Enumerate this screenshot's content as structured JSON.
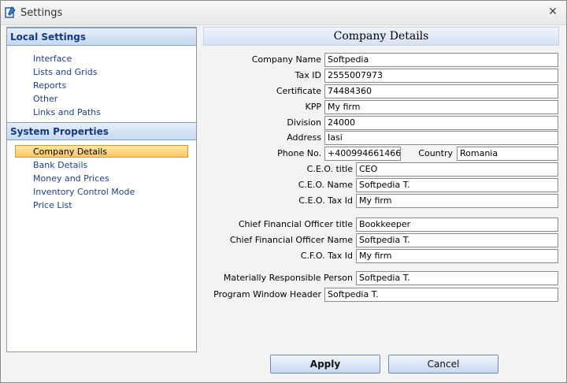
{
  "window": {
    "title": "Settings",
    "close_glyph": "✕"
  },
  "sidebar": {
    "local_settings": {
      "header": "Local Settings",
      "items": [
        "Interface",
        "Lists and Grids",
        "Reports",
        "Other",
        "Links and Paths"
      ]
    },
    "system_properties": {
      "header": "System Properties",
      "items": [
        "Company Details",
        "Bank Details",
        "Money and Prices",
        "Inventory Control Mode",
        "Price List"
      ],
      "selected": "Company Details"
    }
  },
  "main": {
    "heading": "Company Details",
    "fields": {
      "company_name": {
        "label": "Company Name",
        "value": "Softpedia"
      },
      "tax_id": {
        "label": "Tax ID",
        "value": "2555007973"
      },
      "certificate": {
        "label": "Certificate",
        "value": "74484360"
      },
      "kpp": {
        "label": "KPP",
        "value": "My firm"
      },
      "division": {
        "label": "Division",
        "value": "24000"
      },
      "address": {
        "label": "Address",
        "value": "Iasi"
      },
      "phone": {
        "label": "Phone No.",
        "value": "+400994661466"
      },
      "country": {
        "label": "Country",
        "value": "Romania"
      },
      "ceo_title": {
        "label": "C.E.O. title",
        "value": "CEO"
      },
      "ceo_name": {
        "label": "C.E.O. Name",
        "value": "Softpedia T."
      },
      "ceo_tax_id": {
        "label": "C.E.O. Tax Id",
        "value": "My firm"
      },
      "cfo_title": {
        "label": "Chief Financial Officer title",
        "value": "Bookkeeper"
      },
      "cfo_name": {
        "label": "Chief Financial Officer Name",
        "value": "Softpedia T."
      },
      "cfo_tax_id": {
        "label": "C.F.O. Tax Id",
        "value": "My firm"
      },
      "mrp": {
        "label": "Materially Responsible Person",
        "value": "Softpedia T."
      },
      "window_header": {
        "label": "Program Window Header",
        "value": "Softpedia T."
      }
    }
  },
  "buttons": {
    "apply": "Apply",
    "cancel": "Cancel"
  },
  "colors": {
    "accent": "#123a84",
    "selection": "#ffc861"
  },
  "icons": {
    "app": "settings-app-icon",
    "close": "close-icon"
  }
}
